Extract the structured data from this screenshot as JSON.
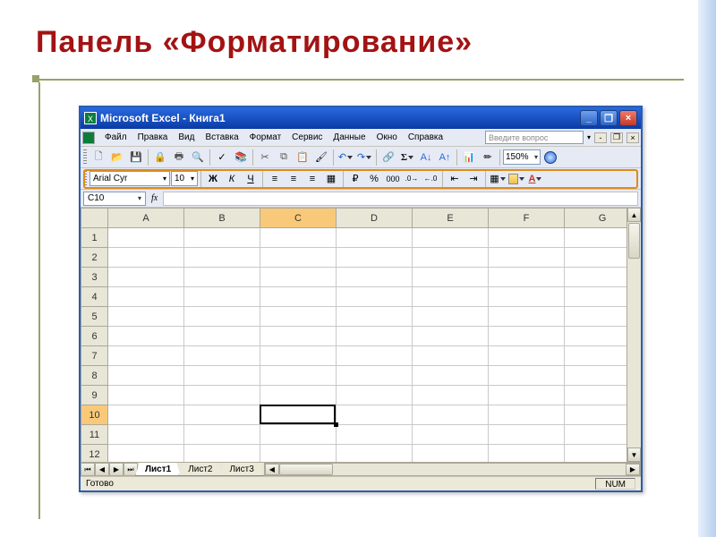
{
  "slide": {
    "title": "Панель «Форматирование»"
  },
  "titlebar": {
    "text": "Microsoft Excel - Книга1"
  },
  "window_controls": {
    "min": "_",
    "max": "❐",
    "close": "×"
  },
  "menu": {
    "items": [
      "Файл",
      "Правка",
      "Вид",
      "Вставка",
      "Формат",
      "Сервис",
      "Данные",
      "Окно",
      "Справка"
    ],
    "help_placeholder": "Введите вопрос"
  },
  "standard_toolbar": {
    "zoom": "150%"
  },
  "formatting_toolbar": {
    "font_name": "Arial Cyr",
    "font_size": "10",
    "bold": "Ж",
    "italic": "К",
    "underline": "Ч"
  },
  "namebox": {
    "ref": "C10",
    "fx": "fx"
  },
  "columns": [
    "A",
    "B",
    "C",
    "D",
    "E",
    "F",
    "G"
  ],
  "rows": [
    "1",
    "2",
    "3",
    "4",
    "5",
    "6",
    "7",
    "8",
    "9",
    "10",
    "11",
    "12"
  ],
  "active": {
    "col": "C",
    "row": "10"
  },
  "tabs": {
    "sheets": [
      "Лист1",
      "Лист2",
      "Лист3"
    ],
    "active": 0,
    "nav": {
      "first": "⏮",
      "prev": "◀",
      "next": "▶",
      "last": "⏭"
    }
  },
  "status": {
    "ready": "Готово",
    "num": "NUM"
  }
}
